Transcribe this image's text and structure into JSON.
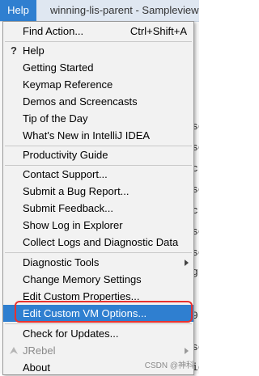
{
  "menubar": {
    "help": "Help",
    "window_title": "winning-lis-parent - Sampleview"
  },
  "menu": {
    "items": [
      {
        "label": "Find Action...",
        "shortcut": "Ctrl+Shift+A"
      },
      {
        "label": "Help",
        "icon": "question-mark-icon"
      },
      {
        "label": "Getting Started"
      },
      {
        "label": "Keymap Reference"
      },
      {
        "label": "Demos and Screencasts"
      },
      {
        "label": "Tip of the Day"
      },
      {
        "label": "What's New in IntelliJ IDEA"
      },
      {
        "label": "Productivity Guide"
      },
      {
        "label": "Contact Support..."
      },
      {
        "label": "Submit a Bug Report..."
      },
      {
        "label": "Submit Feedback..."
      },
      {
        "label": "Show Log in Explorer"
      },
      {
        "label": "Collect Logs and Diagnostic Data"
      },
      {
        "label": "Diagnostic Tools",
        "submenu": true
      },
      {
        "label": "Change Memory Settings"
      },
      {
        "label": "Edit Custom Properties..."
      },
      {
        "label": "Edit Custom VM Options...",
        "selected": true
      },
      {
        "label": "Check for Updates..."
      },
      {
        "label": "JRebel",
        "submenu": true,
        "disabled": true,
        "icon": "jrebel-icon"
      },
      {
        "label": "About"
      }
    ]
  },
  "background_code": [
    "se",
    "se",
    "cl",
    "se",
    "cl",
    "se",
    "se",
    "g",
    "9",
    "se",
    "ig"
  ],
  "watermark": "CSDN @神科",
  "colors": {
    "selection": "#2f7fd0",
    "highlight_box": "#e8322e",
    "menu_bg": "#f2f2f2"
  }
}
